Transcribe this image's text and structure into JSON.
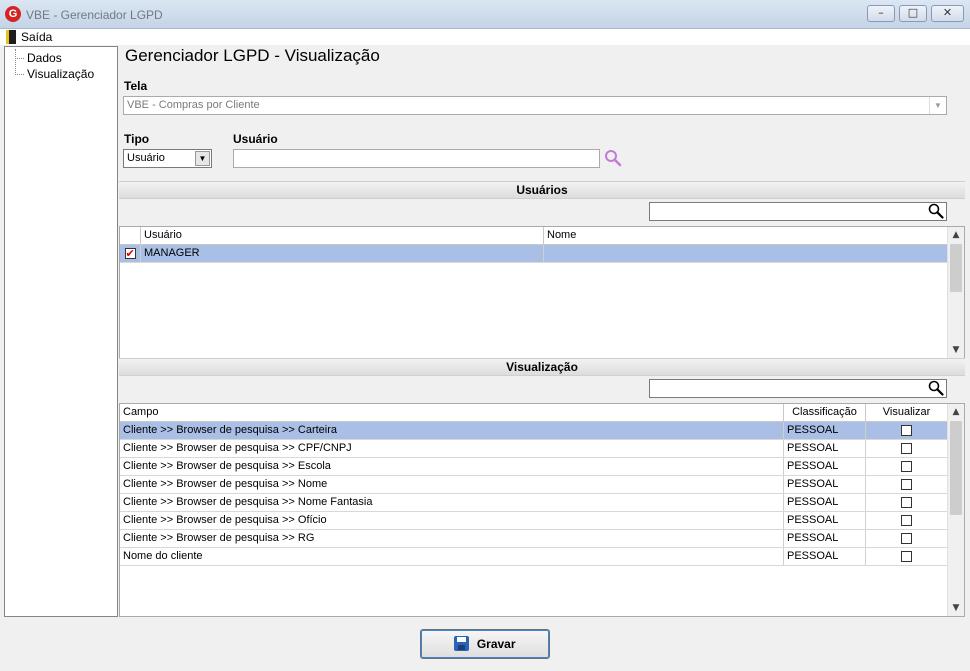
{
  "window": {
    "title": "VBE - Gerenciador LGPD",
    "logo_letter": "G",
    "min_glyph": "–",
    "max_glyph": "□",
    "close_glyph": "✕"
  },
  "menu": {
    "exit_label": "Saída"
  },
  "tree": {
    "items": [
      "Dados",
      "Visualização"
    ]
  },
  "page_title": "Gerenciador LGPD - Visualização",
  "form": {
    "tela_label": "Tela",
    "tela_value": "VBE - Compras por Cliente",
    "tipo_label": "Tipo",
    "tipo_value": "Usuário",
    "usuario_label": "Usuário",
    "usuario_value": "",
    "dropdown_glyph": "▼"
  },
  "users_section": {
    "title": "Usuários",
    "filter_value": "",
    "columns": [
      "Usuário",
      "Nome"
    ],
    "rows": [
      {
        "checked": true,
        "usuario": "MANAGER",
        "nome": ""
      }
    ]
  },
  "vis_section": {
    "title": "Visualização",
    "filter_value": "",
    "columns": [
      "Campo",
      "Classificação",
      "Visualizar"
    ],
    "rows": [
      {
        "campo": "Cliente >> Browser de pesquisa >> Carteira",
        "classificacao": "PESSOAL",
        "visualizar": false,
        "selected": true
      },
      {
        "campo": "Cliente >> Browser de pesquisa >> CPF/CNPJ",
        "classificacao": "PESSOAL",
        "visualizar": false
      },
      {
        "campo": "Cliente >> Browser de pesquisa >> Escola",
        "classificacao": "PESSOAL",
        "visualizar": false
      },
      {
        "campo": "Cliente >> Browser de pesquisa >> Nome",
        "classificacao": "PESSOAL",
        "visualizar": false
      },
      {
        "campo": "Cliente >> Browser de pesquisa >> Nome Fantasia",
        "classificacao": "PESSOAL",
        "visualizar": false
      },
      {
        "campo": "Cliente >> Browser de pesquisa >> Ofício",
        "classificacao": "PESSOAL",
        "visualizar": false
      },
      {
        "campo": "Cliente >> Browser de pesquisa >> RG",
        "classificacao": "PESSOAL",
        "visualizar": false
      },
      {
        "campo": "Nome do cliente",
        "classificacao": "PESSOAL",
        "visualizar": false
      }
    ]
  },
  "scroll": {
    "up_glyph": "▲",
    "down_glyph": "▼"
  },
  "actions": {
    "save_label": "Gravar"
  },
  "colors": {
    "selection": "#a9bfe6",
    "accent": "#2a62b8",
    "search_icon": "#c27bd6"
  }
}
